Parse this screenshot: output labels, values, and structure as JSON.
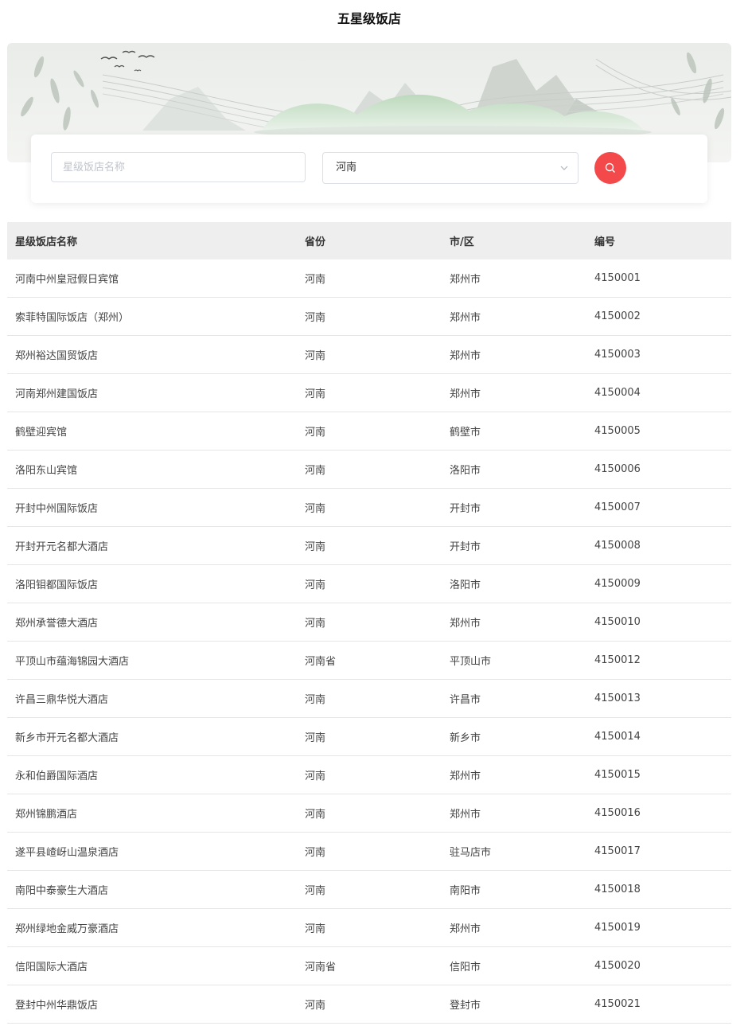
{
  "page": {
    "title": "五星级饭店"
  },
  "search": {
    "name_placeholder": "星级饭店名称",
    "name_value": "",
    "province_value": "河南",
    "button_color": "#f3494b"
  },
  "table": {
    "headers": [
      "星级饭店名称",
      "省份",
      "市/区",
      "编号"
    ],
    "rows": [
      [
        "河南中州皇冠假日宾馆",
        "河南",
        "郑州市",
        "4150001"
      ],
      [
        "索菲特国际饭店（郑州）",
        "河南",
        "郑州市",
        "4150002"
      ],
      [
        "郑州裕达国贸饭店",
        "河南",
        "郑州市",
        "4150003"
      ],
      [
        "河南郑州建国饭店",
        "河南",
        "郑州市",
        "4150004"
      ],
      [
        "鹤壁迎宾馆",
        "河南",
        "鹤壁市",
        "4150005"
      ],
      [
        "洛阳东山宾馆",
        "河南",
        "洛阳市",
        "4150006"
      ],
      [
        "开封中州国际饭店",
        "河南",
        "开封市",
        "4150007"
      ],
      [
        "开封开元名都大酒店",
        "河南",
        "开封市",
        "4150008"
      ],
      [
        "洛阳钼都国际饭店",
        "河南",
        "洛阳市",
        "4150009"
      ],
      [
        "郑州承誉德大酒店",
        "河南",
        "郑州市",
        "4150010"
      ],
      [
        "平顶山市蕴海锦园大酒店",
        "河南省",
        "平顶山市",
        "4150012"
      ],
      [
        "许昌三鼎华悦大酒店",
        "河南",
        "许昌市",
        "4150013"
      ],
      [
        "新乡市开元名都大酒店",
        "河南",
        "新乡市",
        "4150014"
      ],
      [
        "永和伯爵国际酒店",
        "河南",
        "郑州市",
        "4150015"
      ],
      [
        "郑州锦鹏酒店",
        "河南",
        "郑州市",
        "4150016"
      ],
      [
        "遂平县嵖岈山温泉酒店",
        "河南",
        "驻马店市",
        "4150017"
      ],
      [
        "南阳中泰豪生大酒店",
        "河南",
        "南阳市",
        "4150018"
      ],
      [
        "郑州绿地金威万豪酒店",
        "河南",
        "郑州市",
        "4150019"
      ],
      [
        "信阳国际大酒店",
        "河南省",
        "信阳市",
        "4150020"
      ],
      [
        "登封中州华鼎饭店",
        "河南",
        "登封市",
        "4150021"
      ]
    ]
  }
}
